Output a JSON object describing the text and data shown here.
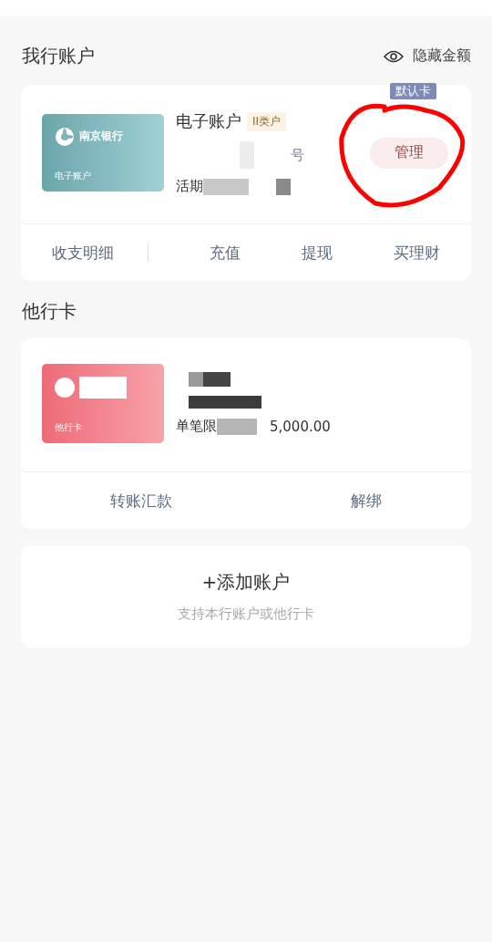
{
  "own_section": {
    "title": "我行账户",
    "hide_amount": "隐藏金额"
  },
  "own_account": {
    "card_image": {
      "bank": "南京银行",
      "label": "电子账户"
    },
    "name": "电子账户",
    "tier": "II类户",
    "number_fragment": "号",
    "type_fragment": "活期",
    "badge": "默认卡",
    "manage_button": "管理",
    "actions": [
      "收支明细",
      "充值",
      "提现",
      "买理财"
    ]
  },
  "other_section": {
    "title": "他行卡"
  },
  "other_card": {
    "card_label": "他行卡",
    "limit_fragment": "单笔限",
    "limit_amount": "5,000.00",
    "actions": [
      "转账汇款",
      "解绑"
    ]
  },
  "add_account": {
    "label": "+添加账户",
    "hint": "支持本行账户或他行卡"
  }
}
